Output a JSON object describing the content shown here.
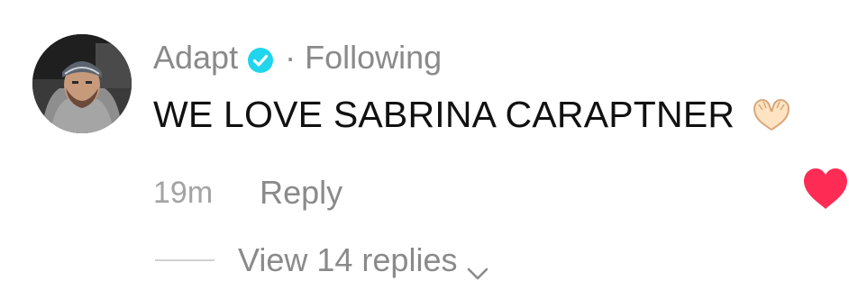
{
  "comment": {
    "username": "Adapt",
    "separator": "·",
    "relationship": "Following",
    "text": "WE LOVE SABRINA CARAPTNER",
    "emoji_icon": "heart-hands-icon",
    "timestamp": "19m",
    "reply_label": "Reply",
    "view_replies_label": "View 14 replies",
    "verified_icon": "verified-badge-icon",
    "like_icon": "heart-icon",
    "liked": true
  },
  "colors": {
    "verified": "#20D5EC",
    "like": "#FE2C55",
    "muted_text": "#8A8A8A",
    "body_text": "#111111"
  }
}
